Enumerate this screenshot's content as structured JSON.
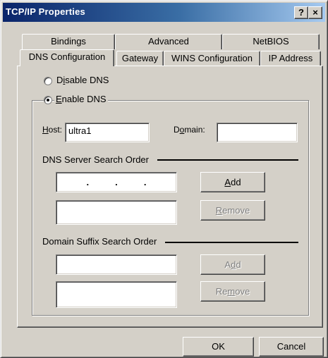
{
  "window": {
    "title": "TCP/IP Properties",
    "help_label": "?",
    "close_label": "×"
  },
  "tabs": {
    "back_row": [
      "Bindings",
      "Advanced",
      "NetBIOS"
    ],
    "front_row": [
      "DNS Configuration",
      "Gateway",
      "WINS Configuration",
      "IP Address"
    ],
    "selected": "DNS Configuration"
  },
  "dns": {
    "disable_prefix": "D",
    "disable_access": "i",
    "disable_rest": "sable DNS",
    "enable_access": "E",
    "enable_rest": "nable DNS",
    "selected_option": "Enable DNS"
  },
  "host": {
    "label_access": "H",
    "label_rest": "ost:",
    "value": "ultra1"
  },
  "domain": {
    "label_prefix": "D",
    "label_access": "o",
    "label_rest": "main:",
    "value": ""
  },
  "dns_server": {
    "heading": "DNS Server Search Order",
    "ip_dots": [
      ".",
      ".",
      "."
    ],
    "add_access": "A",
    "add_rest": "dd",
    "remove_access": "R",
    "remove_rest": "emove"
  },
  "domain_suffix": {
    "heading": "Domain Suffix Search Order",
    "add_prefix": "A",
    "add_access": "d",
    "add_rest": "d",
    "remove_prefix": "Re",
    "remove_access": "m",
    "remove_rest": "ove"
  },
  "footer": {
    "ok_label": "OK",
    "cancel_label": "Cancel"
  }
}
